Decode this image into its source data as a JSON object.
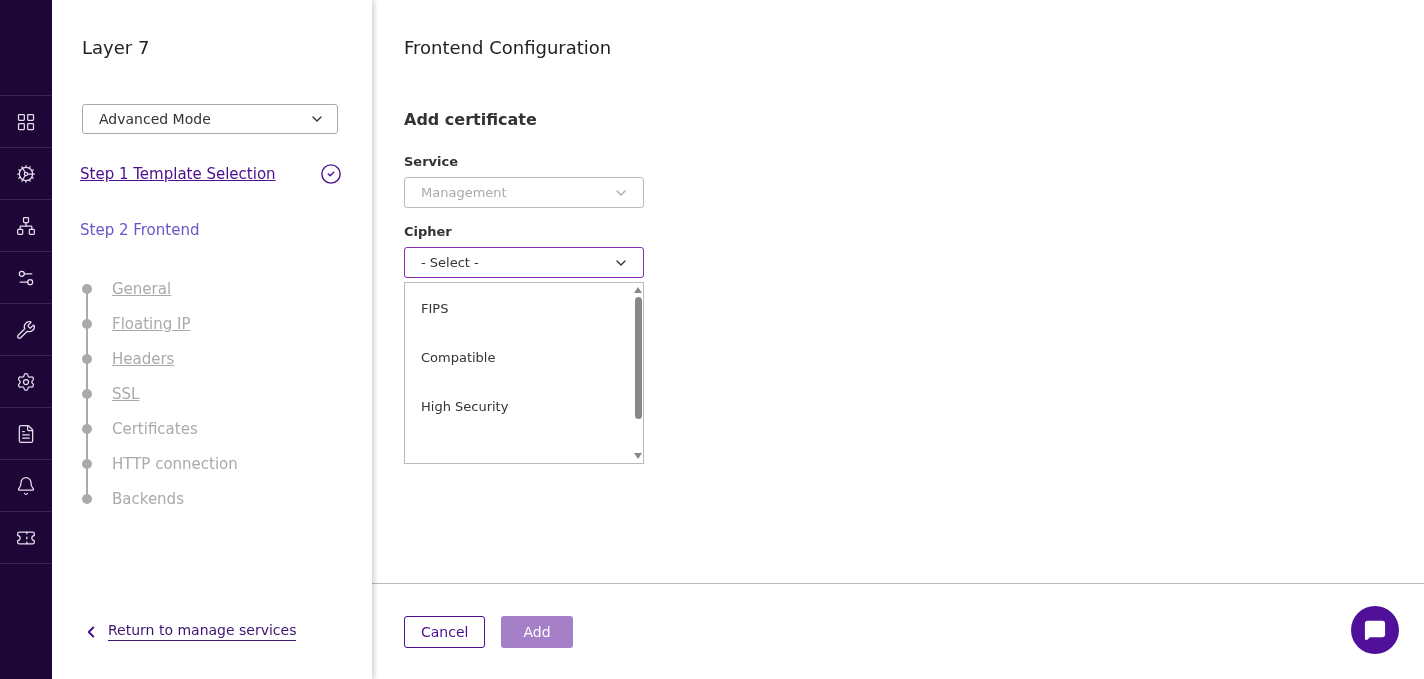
{
  "rail": {
    "items": [
      {
        "kind": "grid"
      },
      {
        "kind": "cog-pin"
      },
      {
        "kind": "network"
      },
      {
        "kind": "cogs"
      },
      {
        "kind": "tools"
      },
      {
        "kind": "cog"
      },
      {
        "kind": "log"
      },
      {
        "kind": "bell"
      },
      {
        "kind": "ticket"
      }
    ]
  },
  "sidebar": {
    "title": "Layer 7",
    "mode": {
      "value": "Advanced Mode"
    },
    "steps": [
      {
        "label": "Step 1 Template Selection",
        "completed": true,
        "selected": false
      },
      {
        "label": "Step 2 Frontend",
        "completed": false,
        "selected": true
      }
    ],
    "substeps": [
      {
        "label": "General",
        "visited": true
      },
      {
        "label": "Floating IP",
        "visited": true
      },
      {
        "label": "Headers",
        "visited": true
      },
      {
        "label": "SSL",
        "visited": true
      },
      {
        "label": "Certificates",
        "visited": false
      },
      {
        "label": "HTTP connection",
        "visited": false
      },
      {
        "label": "Backends",
        "visited": false
      }
    ],
    "return_link": "Return to manage services"
  },
  "main": {
    "title": "Frontend Configuration",
    "section": "Add certificate",
    "fields": [
      {
        "label": "Service",
        "value": "Management",
        "disabled": true,
        "focused": false
      },
      {
        "label": "Cipher",
        "value": "- Select -",
        "disabled": false,
        "focused": true
      }
    ],
    "options": [
      "FIPS",
      "Compatible",
      "High Security"
    ],
    "buttons": [
      {
        "label": "Cancel",
        "kind": "outline",
        "disabled": false
      },
      {
        "label": "Add",
        "kind": "primary",
        "disabled": true
      }
    ]
  }
}
